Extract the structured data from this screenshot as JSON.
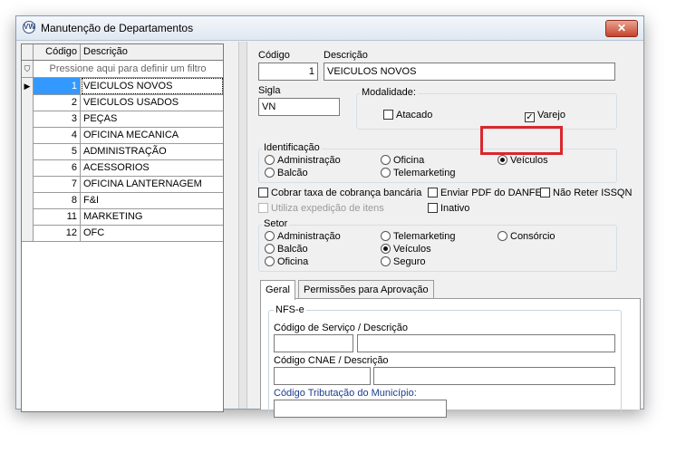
{
  "window": {
    "title": "Manutenção de Departamentos",
    "close_symbol": "✕"
  },
  "grid": {
    "headers": [
      "Código",
      "Descrição"
    ],
    "filter_text": "Pressione aqui para definir um filtro",
    "rows": [
      {
        "codigo": "1",
        "descricao": "VEICULOS NOVOS"
      },
      {
        "codigo": "2",
        "descricao": "VEICULOS USADOS"
      },
      {
        "codigo": "3",
        "descricao": "PEÇAS"
      },
      {
        "codigo": "4",
        "descricao": "OFICINA MECANICA"
      },
      {
        "codigo": "5",
        "descricao": "ADMINISTRAÇÃO"
      },
      {
        "codigo": "6",
        "descricao": "ACESSORIOS"
      },
      {
        "codigo": "7",
        "descricao": "OFICINA LANTERNAGEM"
      },
      {
        "codigo": "8",
        "descricao": "F&I"
      },
      {
        "codigo": "11",
        "descricao": "MARKETING"
      },
      {
        "codigo": "12",
        "descricao": "OFC"
      }
    ],
    "selected_index": 0
  },
  "form": {
    "codigo_label": "Código",
    "codigo_value": "1",
    "descricao_label": "Descrição",
    "descricao_value": "VEICULOS NOVOS",
    "sigla_label": "Sigla",
    "sigla_value": "VN",
    "modalidade_label": "Modalidade:",
    "atacado_label": "Atacado",
    "atacado_checked": false,
    "varejo_label": "Varejo",
    "varejo_checked": true,
    "identificacao_label": "Identificação",
    "identificacao_options": [
      "Administração",
      "Balcão",
      "Oficina",
      "Telemarketing",
      "Veículos"
    ],
    "identificacao_selected": "Veículos",
    "cobrar_label": "Cobrar taxa de cobrança bancária",
    "enviar_pdf_label": "Enviar PDF do DANFE",
    "nao_reter_label": "Não Reter ISSQN",
    "utiliza_label": "Utiliza expedição de itens",
    "inativo_label": "Inativo",
    "setor_label": "Setor",
    "setor_options": [
      "Administração",
      "Balcão",
      "Oficina",
      "Telemarketing",
      "Veículos",
      "Seguro",
      "Consórcio"
    ],
    "setor_selected": "Veículos",
    "check_mark": "✓"
  },
  "tabs": {
    "geral": "Geral",
    "permissoes": "Permissões para Aprovação"
  },
  "nfse": {
    "group_label": "NFS-e",
    "servico_label": "Código de Serviço / Descrição",
    "cnae_label": "Código CNAE / Descrição",
    "tributacao_label": "Código Tributação do Município:"
  },
  "icons": {
    "app": "vw-logo-icon",
    "filter": "filter-icon",
    "row_pointer": "row-pointer-icon"
  },
  "colors": {
    "selection": "#3399ff",
    "highlight": "#d9272e",
    "close": "#c7432b"
  }
}
